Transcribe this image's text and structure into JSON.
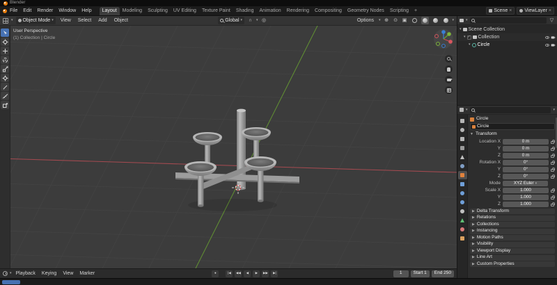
{
  "titlebar": {
    "title": "Blender"
  },
  "topbar": {
    "menus": [
      "File",
      "Edit",
      "Render",
      "Window",
      "Help"
    ],
    "workspaces": [
      "Layout",
      "Modeling",
      "Sculpting",
      "UV Editing",
      "Texture Paint",
      "Shading",
      "Animation",
      "Rendering",
      "Compositing",
      "Geometry Nodes",
      "Scripting"
    ],
    "add_workspace": "+",
    "active_workspace": "Layout",
    "scene_selector": {
      "label": "Scene"
    },
    "view_layer_selector": {
      "label": "ViewLayer"
    }
  },
  "viewport_header": {
    "mode_selector": "Object Mode",
    "menus": [
      "View",
      "Select",
      "Add",
      "Object"
    ],
    "transform_orientation": "Global",
    "options_label": "Options"
  },
  "viewport_overlay": {
    "view_label": "User Perspective",
    "context_label": "(1) Collection | Circle"
  },
  "outliner": {
    "rows": [
      {
        "label": "Scene Collection"
      },
      {
        "label": "Collection"
      },
      {
        "label": "Circle"
      }
    ]
  },
  "properties": {
    "breadcrumb_object": "Circle",
    "object_name": "Circle",
    "transform_section_label": "Transform",
    "fields": [
      {
        "label": "Location X",
        "value": "0 m"
      },
      {
        "label": "Y",
        "value": "0 m"
      },
      {
        "label": "Z",
        "value": "0 m"
      },
      {
        "label": "Rotation X",
        "value": "0°"
      },
      {
        "label": "Y",
        "value": "0°"
      },
      {
        "label": "Z",
        "value": "0°"
      },
      {
        "label": "Scale X",
        "value": "1.000"
      },
      {
        "label": "Y",
        "value": "1.000"
      },
      {
        "label": "Z",
        "value": "1.000"
      }
    ],
    "mode_row": {
      "label": "Mode",
      "value": "XYZ Euler"
    },
    "collapsed_sections": [
      "Delta Transform",
      "Relations",
      "Collections",
      "Instancing",
      "Motion Paths",
      "Visibility",
      "Viewport Display",
      "Line Art",
      "Custom Properties"
    ]
  },
  "timeline": {
    "menus": [
      "Playback",
      "Keying",
      "View",
      "Marker"
    ],
    "current_frame": "1",
    "start_field": "Start 1",
    "end_field": "End 250"
  },
  "icons": {
    "caret_down": "▾",
    "panel_open": "▼",
    "panel_closed": "▶",
    "close": "×",
    "check": "✓",
    "filter": "▽",
    "magnet": "∩",
    "prop_edit": "◎",
    "gizmo_toggle": "⊕",
    "overlays": "⊙",
    "xray": "▣",
    "record": "●",
    "jump_start": "|◀",
    "prev_key": "◀◀",
    "play_rev": "◀",
    "play": "▶",
    "next_key": "▶▶",
    "jump_end": "▶|"
  },
  "colors": {
    "accent": "#4772b3",
    "object_tab": "#e0823d",
    "axis_x": "#a34a50",
    "axis_y": "#5f8c33",
    "axis_z": "#3a7fd5"
  }
}
